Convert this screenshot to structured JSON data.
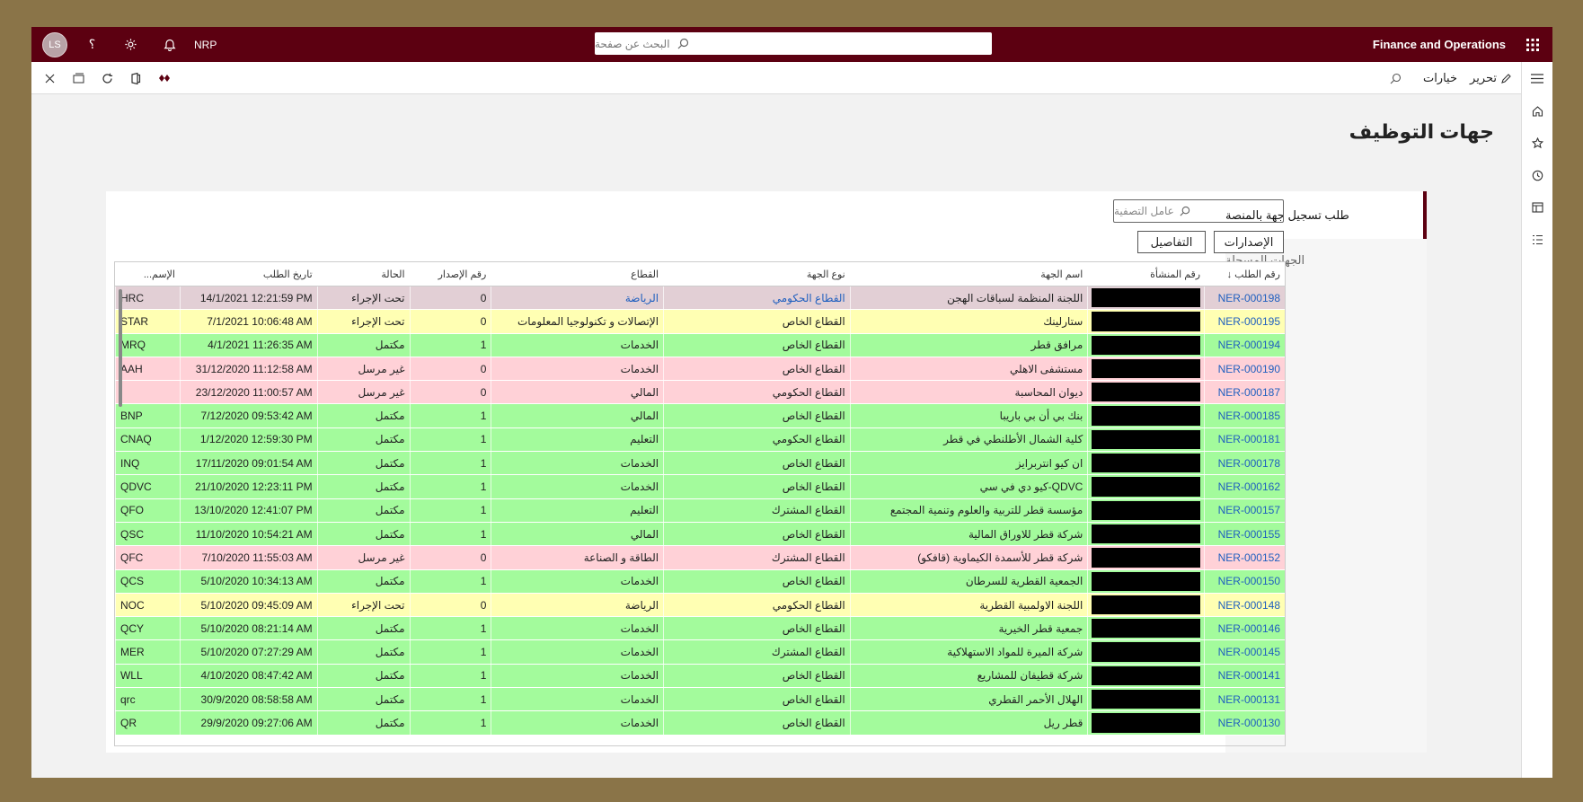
{
  "topbar": {
    "app_title": "Finance and Operations",
    "search_placeholder": "البحث عن صفحة",
    "company": "NRP",
    "avatar": "LS",
    "help": "؟"
  },
  "cmdbar": {
    "edit_label": "تحرير",
    "options_label": "خيارات"
  },
  "page": {
    "title": "جهات التوظيف"
  },
  "tabs": [
    {
      "label": "طلب تسجيل جهة بالمنصة",
      "active": true
    },
    {
      "label": "الجهات المسجلة",
      "active": false
    }
  ],
  "filter": {
    "placeholder": "عامل التصفية"
  },
  "actions": {
    "releases": "الإصدارات",
    "details": "التفاصيل"
  },
  "colors": {
    "topbar": "#5c0011",
    "green": "#a3fb9c",
    "yellow": "#ffffb3",
    "pink": "#ffd1d7",
    "selected": "#e2cfd5",
    "link": "#1f5fbf"
  },
  "grid": {
    "headers": [
      "رقم الطلب ↓",
      "رقم المنشأة",
      "اسم الجهة",
      "نوع الجهة",
      "القطاع",
      "رقم الإصدار",
      "الحالة",
      "تاريخ الطلب",
      "الإسم..."
    ],
    "rows": [
      {
        "id": "NER-000198",
        "name": "اللجنة المنظمة لسباقات الهجن",
        "type": "القطاع الحكومي",
        "sector": "الرياضة",
        "rel": "0",
        "status": "تحت الإجراء",
        "date": "14/1/2021 12:21:59 PM",
        "abbr": "HRC",
        "color": "selected"
      },
      {
        "id": "NER-000195",
        "name": "ستارلينك",
        "type": "القطاع الخاص",
        "sector": "الإتصالات و تكنولوجيا المعلومات",
        "rel": "0",
        "status": "تحت الإجراء",
        "date": "7/1/2021 10:06:48 AM",
        "abbr": "STAR",
        "color": "yellow"
      },
      {
        "id": "NER-000194",
        "name": "مرافق قطر",
        "type": "القطاع الخاص",
        "sector": "الخدمات",
        "rel": "1",
        "status": "مكتمل",
        "date": "4/1/2021 11:26:35 AM",
        "abbr": "MRQ",
        "color": "green"
      },
      {
        "id": "NER-000190",
        "name": "مستشفى الاهلي",
        "type": "القطاع الخاص",
        "sector": "الخدمات",
        "rel": "0",
        "status": "غير مرسل",
        "date": "31/12/2020 11:12:58 AM",
        "abbr": "AAH",
        "color": "pink"
      },
      {
        "id": "NER-000187",
        "name": "ديوان المحاسبة",
        "type": "القطاع الحكومي",
        "sector": "المالي",
        "rel": "0",
        "status": "غير مرسل",
        "date": "23/12/2020 11:00:57 AM",
        "abbr": "",
        "color": "pink"
      },
      {
        "id": "NER-000185",
        "name": "بنك بي أن بي باريبا",
        "type": "القطاع الخاص",
        "sector": "المالي",
        "rel": "1",
        "status": "مكتمل",
        "date": "7/12/2020 09:53:42 AM",
        "abbr": "BNP",
        "color": "green"
      },
      {
        "id": "NER-000181",
        "name": "كلية الشمال الأطلنطي في قطر",
        "type": "القطاع الحكومي",
        "sector": "التعليم",
        "rel": "1",
        "status": "مكتمل",
        "date": "1/12/2020 12:59:30 PM",
        "abbr": "CNAQ",
        "color": "green"
      },
      {
        "id": "NER-000178",
        "name": "ان كيو انتربرايز",
        "type": "القطاع الخاص",
        "sector": "الخدمات",
        "rel": "1",
        "status": "مكتمل",
        "date": "17/11/2020 09:01:54 AM",
        "abbr": "INQ",
        "color": "green"
      },
      {
        "id": "NER-000162",
        "name": "QDVC-كيو دي في سي",
        "type": "القطاع الخاص",
        "sector": "الخدمات",
        "rel": "1",
        "status": "مكتمل",
        "date": "21/10/2020 12:23:11 PM",
        "abbr": "QDVC",
        "color": "green"
      },
      {
        "id": "NER-000157",
        "name": "مؤسسة قطر للتربية والعلوم وتنمية المجتمع",
        "type": "القطاع المشترك",
        "sector": "التعليم",
        "rel": "1",
        "status": "مكتمل",
        "date": "13/10/2020 12:41:07 PM",
        "abbr": "QFO",
        "color": "green"
      },
      {
        "id": "NER-000155",
        "name": "شركة قطر للاوراق المالية",
        "type": "القطاع الخاص",
        "sector": "المالي",
        "rel": "1",
        "status": "مكتمل",
        "date": "11/10/2020 10:54:21 AM",
        "abbr": "QSC",
        "color": "green"
      },
      {
        "id": "NER-000152",
        "name": "شركة قطر للأسمدة الكيماوية (قافكو)",
        "type": "القطاع المشترك",
        "sector": "الطاقة و الصناعة",
        "rel": "0",
        "status": "غير مرسل",
        "date": "7/10/2020 11:55:03 AM",
        "abbr": "QFC",
        "color": "pink"
      },
      {
        "id": "NER-000150",
        "name": "الجمعية القطرية للسرطان",
        "type": "القطاع الخاص",
        "sector": "الخدمات",
        "rel": "1",
        "status": "مكتمل",
        "date": "5/10/2020 10:34:13 AM",
        "abbr": "QCS",
        "color": "green"
      },
      {
        "id": "NER-000148",
        "name": "اللجنة الاولمبية القطرية",
        "type": "القطاع الحكومي",
        "sector": "الرياضة",
        "rel": "0",
        "status": "تحت الإجراء",
        "date": "5/10/2020 09:45:09 AM",
        "abbr": "NOC",
        "color": "yellow"
      },
      {
        "id": "NER-000146",
        "name": "جمعية قطر الخيرية",
        "type": "القطاع الخاص",
        "sector": "الخدمات",
        "rel": "1",
        "status": "مكتمل",
        "date": "5/10/2020 08:21:14 AM",
        "abbr": "QCY",
        "color": "green"
      },
      {
        "id": "NER-000145",
        "name": "شركة الميرة للمواد الاستهلاكية",
        "type": "القطاع المشترك",
        "sector": "الخدمات",
        "rel": "1",
        "status": "مكتمل",
        "date": "5/10/2020 07:27:29 AM",
        "abbr": "MER",
        "color": "green"
      },
      {
        "id": "NER-000141",
        "name": "شركة قطيفان للمشاريع",
        "type": "القطاع الخاص",
        "sector": "الخدمات",
        "rel": "1",
        "status": "مكتمل",
        "date": "4/10/2020 08:47:42 AM",
        "abbr": "WLL",
        "color": "green"
      },
      {
        "id": "NER-000131",
        "name": "الهلال الأحمر القطري",
        "type": "القطاع الخاص",
        "sector": "الخدمات",
        "rel": "1",
        "status": "مكتمل",
        "date": "30/9/2020 08:58:58 AM",
        "abbr": "qrc",
        "color": "green"
      },
      {
        "id": "NER-000130",
        "name": "قطر ريل",
        "type": "القطاع الخاص",
        "sector": "الخدمات",
        "rel": "1",
        "status": "مكتمل",
        "date": "29/9/2020 09:27:06 AM",
        "abbr": "QR",
        "color": "green"
      }
    ]
  }
}
